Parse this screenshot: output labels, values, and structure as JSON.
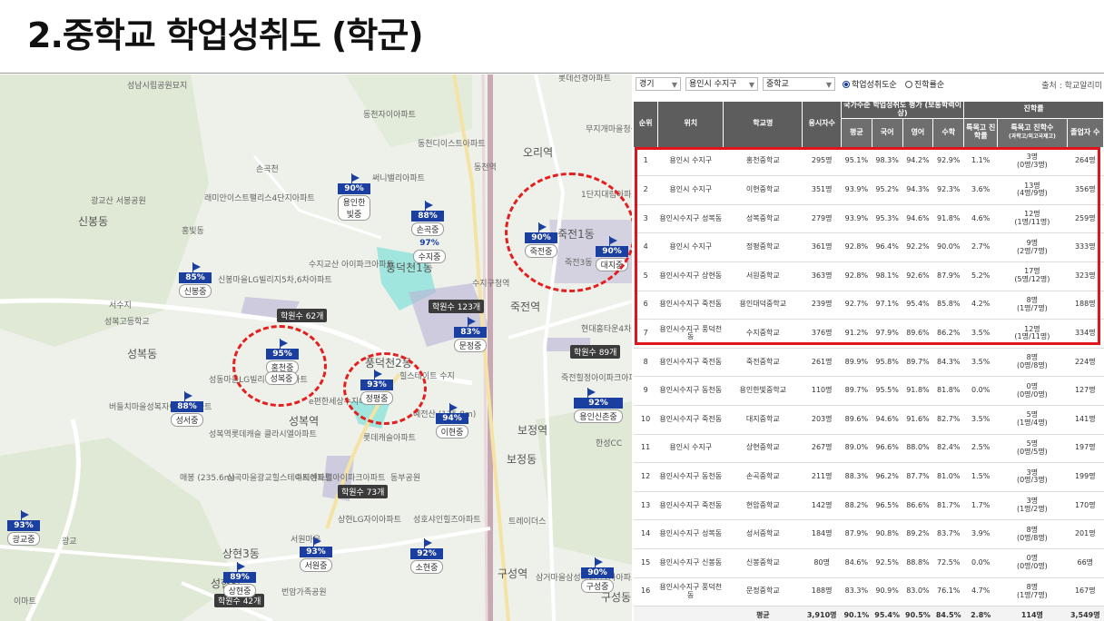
{
  "title": "2.중학교 학업성취도 (학군)",
  "colors": {
    "flag": "#1b3fa0",
    "highlight": "#e0141b",
    "header": "#5d5d5d"
  },
  "map": {
    "places": [
      {
        "t": "성남시립공원묘지"
      },
      {
        "t": "동천자이아파트"
      },
      {
        "t": "동천디이스트아파트"
      },
      {
        "t": "손곡천"
      },
      {
        "t": "써니밸리아파트"
      },
      {
        "t": "래미안이스트팰리스4단지아파트"
      },
      {
        "t": "광교산 서봉공원"
      },
      {
        "t": "신봉동"
      },
      {
        "t": "홍빛동"
      },
      {
        "t": "신봉마을LG빌리지5차,6차아파트"
      },
      {
        "t": "수지교산 아이파크아파트"
      },
      {
        "t": "풍덕천1동"
      },
      {
        "t": "서수지"
      },
      {
        "t": "성복고등학교"
      },
      {
        "t": "성복동"
      },
      {
        "t": "성동마을LG빌리지3차아파트"
      },
      {
        "t": "버들치마을성복자이1차아파트"
      },
      {
        "t": "성복역롯데캐슬 클라시엘아파트"
      },
      {
        "t": "풍덕천2동"
      },
      {
        "t": "힐스테이트 수지"
      },
      {
        "t": "e편한세상수지아파트"
      },
      {
        "t": "성복역"
      },
      {
        "t": "롯데캐슬아파트"
      },
      {
        "t": "예전산 (135.8m)"
      },
      {
        "t": "죽전역"
      },
      {
        "t": "현대홈타운4차5단지아파트"
      },
      {
        "t": "죽전힐정아이파크아파트"
      },
      {
        "t": "보정역"
      },
      {
        "t": "보정동"
      },
      {
        "t": "한성CC"
      },
      {
        "t": "수지센트럴아이파크아파트"
      },
      {
        "t": "동부공원"
      },
      {
        "t": "상현LG자이아파트"
      },
      {
        "t": "성호샤인힐즈아파트"
      },
      {
        "t": "매봉 (235.6m)"
      },
      {
        "t": "심곡마을광교힐스테이트아파트"
      },
      {
        "t": "서원마을"
      },
      {
        "t": "상현3동"
      },
      {
        "t": "성현역"
      },
      {
        "t": "번암가족공원"
      },
      {
        "t": "구성역"
      },
      {
        "t": "삼거마을삼성래미안1차아파트"
      },
      {
        "t": "구성동"
      },
      {
        "t": "트레이더스"
      },
      {
        "t": "롯데선경아파트"
      },
      {
        "t": "오리역"
      },
      {
        "t": "무지개마을청구아파트"
      },
      {
        "t": "1단지대림아파트"
      },
      {
        "t": "죽전1동"
      },
      {
        "t": "죽전3동"
      },
      {
        "t": "광교"
      },
      {
        "t": "이마트"
      },
      {
        "t": "동천역"
      },
      {
        "t": "수지구청역"
      }
    ],
    "pins": [
      {
        "pct": "90%",
        "name": "용인한빛중"
      },
      {
        "pct": "88%",
        "name": "손곡중"
      },
      {
        "pct": "97%",
        "name": "수지중"
      },
      {
        "pct": "85%",
        "name": "신봉중"
      },
      {
        "pct": "95%",
        "name": "홍천중"
      },
      {
        "pct": "93%",
        "name": "정평중"
      },
      {
        "pct": "88%",
        "name": "성서중"
      },
      {
        "pct": "94%",
        "name": "이현중"
      },
      {
        "pct": "83%",
        "name": "문정중"
      },
      {
        "pct": "92%",
        "name": "용인신촌중"
      },
      {
        "pct": "90%",
        "name": "죽전중"
      },
      {
        "pct": "90%",
        "name": "대지중"
      },
      {
        "pct": "93%",
        "name": "광교중"
      },
      {
        "pct": "89%",
        "name": "상현중"
      },
      {
        "pct": "93%",
        "name": "서원중"
      },
      {
        "pct": "92%",
        "name": "소현중"
      },
      {
        "pct": "90%",
        "name": "구성중"
      },
      {
        "pct": "",
        "name": "성복중"
      }
    ],
    "academies": [
      "학원수 62개",
      "학원수 123개",
      "학원수 89개",
      "학원수 73개",
      "학원수 42개"
    ]
  },
  "panel": {
    "filters": {
      "region": "경기",
      "district": "용인시 수지구",
      "level": "중학교"
    },
    "radios": [
      {
        "label": "학업성취도순",
        "selected": true
      },
      {
        "label": "진학률순",
        "selected": false
      }
    ],
    "source": "출처 : 학교알리미",
    "headers": {
      "rank": "순위",
      "loc": "위치",
      "school": "학교명",
      "students": "응시자수",
      "national": "국가수준 학업성취도 평가 (보통학력이상)",
      "advance": "진학률",
      "avg": "평균",
      "kor": "국어",
      "eng": "영어",
      "math": "수학",
      "special": "특목고 진학률",
      "special_detail": "특목고 진학수",
      "special_detail_sub": "(과학고/외고국제고)",
      "grads": "졸업자 수"
    },
    "rows": [
      {
        "rank": "1",
        "loc": "용인시 수지구",
        "school": "홍천중학교",
        "n": "295명",
        "avg": "95.1%",
        "kor": "98.3%",
        "eng": "94.2%",
        "math": "92.9%",
        "sp": "1.1%",
        "spd": "3명",
        "spd2": "(0명/3명)",
        "grad": "264명"
      },
      {
        "rank": "2",
        "loc": "용인시 수지구",
        "school": "이현중학교",
        "n": "351명",
        "avg": "93.9%",
        "kor": "95.2%",
        "eng": "94.3%",
        "math": "92.3%",
        "sp": "3.6%",
        "spd": "13명",
        "spd2": "(4명/9명)",
        "grad": "356명"
      },
      {
        "rank": "3",
        "loc": "용인시수지구 성복동",
        "school": "성복중학교",
        "n": "279명",
        "avg": "93.9%",
        "kor": "95.3%",
        "eng": "94.6%",
        "math": "91.8%",
        "sp": "4.6%",
        "spd": "12명",
        "spd2": "(1명/11명)",
        "grad": "259명"
      },
      {
        "rank": "4",
        "loc": "용인시 수지구",
        "school": "정평중학교",
        "n": "361명",
        "avg": "92.8%",
        "kor": "96.4%",
        "eng": "92.2%",
        "math": "90.0%",
        "sp": "2.7%",
        "spd": "9명",
        "spd2": "(2명/7명)",
        "grad": "333명"
      },
      {
        "rank": "5",
        "loc": "용인시수지구 상현동",
        "school": "서원중학교",
        "n": "363명",
        "avg": "92.8%",
        "kor": "98.1%",
        "eng": "92.6%",
        "math": "87.9%",
        "sp": "5.2%",
        "spd": "17명",
        "spd2": "(5명/12명)",
        "grad": "323명"
      },
      {
        "rank": "6",
        "loc": "용인시수지구 죽전동",
        "school": "용인대덕중학교",
        "n": "239명",
        "avg": "92.7%",
        "kor": "97.1%",
        "eng": "95.4%",
        "math": "85.8%",
        "sp": "4.2%",
        "spd": "8명",
        "spd2": "(1명/7명)",
        "grad": "188명"
      },
      {
        "rank": "7",
        "loc": "용인시수지구 풍덕천동",
        "school": "수지중학교",
        "n": "376명",
        "avg": "91.2%",
        "kor": "97.9%",
        "eng": "89.6%",
        "math": "86.2%",
        "sp": "3.5%",
        "spd": "12명",
        "spd2": "(1명/11명)",
        "grad": "334명"
      },
      {
        "rank": "8",
        "loc": "용인시수지구 죽전동",
        "school": "죽전중학교",
        "n": "261명",
        "avg": "89.9%",
        "kor": "95.8%",
        "eng": "89.7%",
        "math": "84.3%",
        "sp": "3.5%",
        "spd": "8명",
        "spd2": "(0명/8명)",
        "grad": "224명"
      },
      {
        "rank": "9",
        "loc": "용인시수지구 동천동",
        "school": "용인한빛중학교",
        "n": "110명",
        "avg": "89.7%",
        "kor": "95.5%",
        "eng": "91.8%",
        "math": "81.8%",
        "sp": "0.0%",
        "spd": "0명",
        "spd2": "(0명/0명)",
        "grad": "127명"
      },
      {
        "rank": "10",
        "loc": "용인시수지구 죽전동",
        "school": "대지중학교",
        "n": "203명",
        "avg": "89.6%",
        "kor": "94.6%",
        "eng": "91.6%",
        "math": "82.7%",
        "sp": "3.5%",
        "spd": "5명",
        "spd2": "(1명/4명)",
        "grad": "141명"
      },
      {
        "rank": "11",
        "loc": "용인시 수지구",
        "school": "상현중학교",
        "n": "267명",
        "avg": "89.0%",
        "kor": "96.6%",
        "eng": "88.0%",
        "math": "82.4%",
        "sp": "2.5%",
        "spd": "5명",
        "spd2": "(0명/5명)",
        "grad": "197명"
      },
      {
        "rank": "12",
        "loc": "용인시수지구 동천동",
        "school": "손곡중학교",
        "n": "211명",
        "avg": "88.3%",
        "kor": "96.2%",
        "eng": "87.7%",
        "math": "81.0%",
        "sp": "1.5%",
        "spd": "3명",
        "spd2": "(0명/3명)",
        "grad": "199명"
      },
      {
        "rank": "13",
        "loc": "용인시수지구 죽전동",
        "school": "현암중학교",
        "n": "142명",
        "avg": "88.2%",
        "kor": "96.5%",
        "eng": "86.6%",
        "math": "81.7%",
        "sp": "1.7%",
        "spd": "3명",
        "spd2": "(1명/2명)",
        "grad": "170명"
      },
      {
        "rank": "14",
        "loc": "용인시수지구 성복동",
        "school": "성서중학교",
        "n": "184명",
        "avg": "87.9%",
        "kor": "90.8%",
        "eng": "89.2%",
        "math": "83.7%",
        "sp": "3.9%",
        "spd": "8명",
        "spd2": "(0명/8명)",
        "grad": "201명"
      },
      {
        "rank": "15",
        "loc": "용인시수지구 신봉동",
        "school": "신봉중학교",
        "n": "80명",
        "avg": "84.6%",
        "kor": "92.5%",
        "eng": "88.8%",
        "math": "72.5%",
        "sp": "0.0%",
        "spd": "0명",
        "spd2": "(0명/0명)",
        "grad": "66명"
      },
      {
        "rank": "16",
        "loc": "용인시수지구 풍덕천동",
        "school": "문정중학교",
        "n": "188명",
        "avg": "83.3%",
        "kor": "90.9%",
        "eng": "83.0%",
        "math": "76.1%",
        "sp": "4.7%",
        "spd": "8명",
        "spd2": "(1명/7명)",
        "grad": "167명"
      }
    ],
    "total": {
      "label": "평균",
      "n": "3,910명",
      "avg": "90.1%",
      "kor": "95.4%",
      "eng": "90.5%",
      "math": "84.5%",
      "sp": "2.8%",
      "spd": "114명",
      "grad": "3,549명"
    }
  }
}
